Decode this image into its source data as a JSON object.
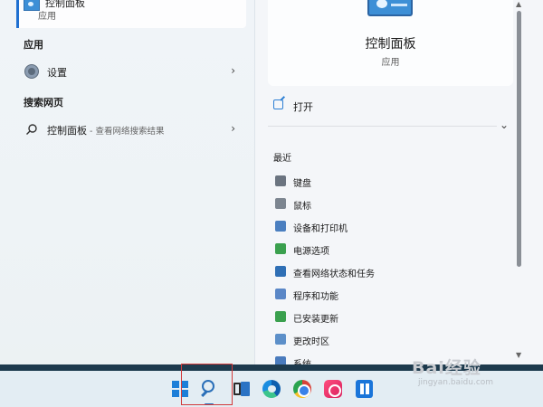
{
  "left": {
    "top_result": {
      "title": "控制面板",
      "subtitle": "应用"
    },
    "section_apps": "应用",
    "app_settings": "设置",
    "section_web": "搜索网页",
    "web_query": "控制面板",
    "web_hint": " - 查看网络搜索结果"
  },
  "right": {
    "title": "控制面板",
    "subtitle": "应用",
    "open_label": "打开",
    "recent_header": "最近",
    "recent_items": [
      {
        "label": "键盘",
        "icon": "keyboard-icon",
        "color": "#6b7480"
      },
      {
        "label": "鼠标",
        "icon": "mouse-icon",
        "color": "#7c8590"
      },
      {
        "label": "设备和打印机",
        "icon": "printer-icon",
        "color": "#4b7fc0"
      },
      {
        "label": "电源选项",
        "icon": "power-icon",
        "color": "#3aa04e"
      },
      {
        "label": "查看网络状态和任务",
        "icon": "network-icon",
        "color": "#2f6fb5"
      },
      {
        "label": "程序和功能",
        "icon": "programs-icon",
        "color": "#5a87c7"
      },
      {
        "label": "已安装更新",
        "icon": "updates-icon",
        "color": "#3aa04e"
      },
      {
        "label": "更改时区",
        "icon": "clock-icon",
        "color": "#5c8fc9"
      },
      {
        "label": "系统",
        "icon": "system-icon",
        "color": "#4a7bbd"
      }
    ]
  },
  "watermark": {
    "brand": "Bai经验",
    "url": "jingyan.baidu.com"
  },
  "colors": {
    "accent": "#1f6fd1",
    "highlight_box": "#d23a3a"
  }
}
